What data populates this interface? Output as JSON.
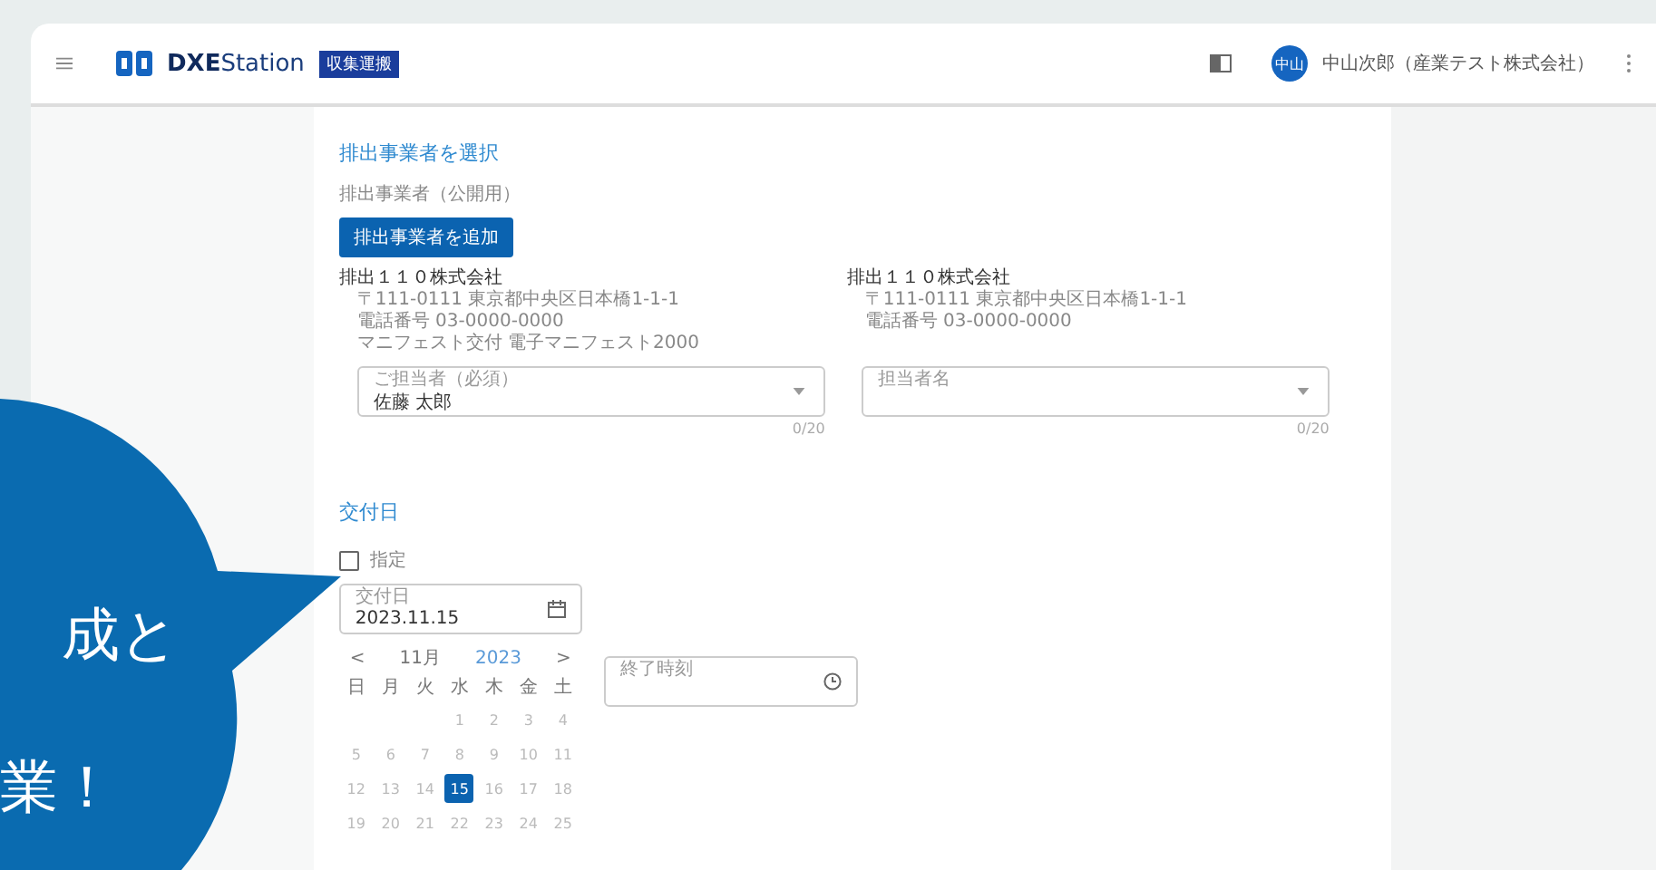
{
  "header": {
    "logo_bold": "DXE",
    "logo_light": "Station",
    "badge": "収集運搬",
    "avatar": "中山",
    "user": "中山次郎（産業テスト株式会社）"
  },
  "discharger": {
    "heading": "排出事業者を選択",
    "subtitle": "排出事業者（公開用）",
    "add_button": "排出事業者を追加",
    "companies": [
      {
        "name": "排出１１０株式会社",
        "lines": [
          "〒111-0111 東京都中央区日本橋1-1-1",
          "電話番号 03-0000-0000",
          "マニフェスト交付 電子マニフェスト2000"
        ]
      },
      {
        "name": "排出１１０株式会社",
        "lines": [
          "〒111-0111 東京都中央区日本橋1-1-1",
          "電話番号 03-0000-0000"
        ]
      }
    ],
    "selects": [
      {
        "label": "ご担当者（必須）",
        "value": "佐藤 太郎",
        "helper": "0/20"
      },
      {
        "label": "担当者名",
        "helper": "0/20"
      }
    ]
  },
  "issue": {
    "heading": "交付日",
    "checkbox": {
      "label": "指定",
      "checked": false
    },
    "date_field": {
      "label": "交付日",
      "value": "2023.11.15"
    },
    "calendar": {
      "prev": "<",
      "month": "11月",
      "year": "2023",
      "next": ">",
      "weekdays": [
        "日",
        "月",
        "火",
        "水",
        "木",
        "金",
        "土"
      ],
      "weeks": [
        [
          {
            "day": "1",
            "selected": false
          },
          {
            "day": "2",
            "selected": false
          },
          {
            "day": "3",
            "selected": false
          },
          {
            "day": "4",
            "selected": false
          }
        ],
        [
          {
            "day": "5",
            "selected": false
          },
          {
            "day": "6",
            "selected": false
          },
          {
            "day": "7",
            "selected": false
          },
          {
            "day": "8",
            "selected": false
          },
          {
            "day": "9",
            "selected": false
          },
          {
            "day": "10",
            "selected": false
          },
          {
            "day": "11",
            "selected": false
          }
        ],
        [
          {
            "day": "12",
            "selected": false
          },
          {
            "day": "13",
            "selected": false
          },
          {
            "day": "14",
            "selected": false
          },
          {
            "day": "15",
            "selected": true
          },
          {
            "day": "16",
            "selected": false
          },
          {
            "day": "17",
            "selected": false
          },
          {
            "day": "18",
            "selected": false
          }
        ],
        [
          {
            "day": "19",
            "selected": false
          },
          {
            "day": "20",
            "selected": false
          },
          {
            "day": "21",
            "selected": false
          },
          {
            "day": "22",
            "selected": false
          },
          {
            "day": "23",
            "selected": false
          },
          {
            "day": "24",
            "selected": false
          },
          {
            "day": "25",
            "selected": false
          }
        ]
      ]
    },
    "time_field": {
      "label": "終了時刻"
    }
  },
  "bubble": {
    "lines": [
      "成と",
      "業！"
    ]
  }
}
